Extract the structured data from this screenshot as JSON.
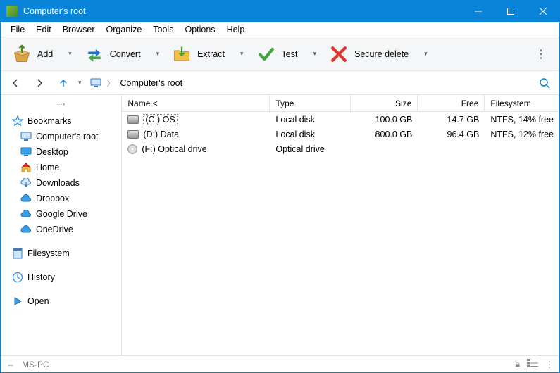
{
  "title": "Computer's root",
  "menu": [
    "File",
    "Edit",
    "Browser",
    "Organize",
    "Tools",
    "Options",
    "Help"
  ],
  "toolbar": {
    "add": "Add",
    "convert": "Convert",
    "extract": "Extract",
    "test": "Test",
    "secure_delete": "Secure delete"
  },
  "breadcrumb": {
    "root": "Computer's root"
  },
  "sidebar": {
    "bookmarks": "Bookmarks",
    "items": [
      {
        "label": "Computer's root"
      },
      {
        "label": "Desktop"
      },
      {
        "label": "Home"
      },
      {
        "label": "Downloads"
      },
      {
        "label": "Dropbox"
      },
      {
        "label": "Google Drive"
      },
      {
        "label": "OneDrive"
      }
    ],
    "filesystem": "Filesystem",
    "history": "History",
    "open": "Open"
  },
  "columns": {
    "name": "Name <",
    "type": "Type",
    "size": "Size",
    "free": "Free",
    "filesystem": "Filesystem"
  },
  "rows": [
    {
      "name": "(C:) OS",
      "type": "Local disk",
      "size": "100.0 GB",
      "free": "14.7 GB",
      "fs": "NTFS, 14% free",
      "icon": "drive",
      "selected": true
    },
    {
      "name": "(D:) Data",
      "type": "Local disk",
      "size": "800.0 GB",
      "free": "96.4 GB",
      "fs": "NTFS, 12% free",
      "icon": "drive",
      "selected": false
    },
    {
      "name": "(F:) Optical drive",
      "type": "Optical drive",
      "size": "",
      "free": "",
      "fs": "",
      "icon": "optical",
      "selected": false
    }
  ],
  "status": {
    "host": "MS-PC"
  }
}
